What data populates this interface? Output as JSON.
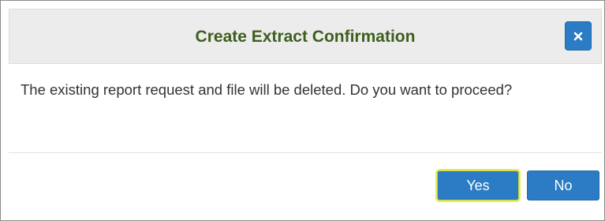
{
  "dialog": {
    "title": "Create Extract Confirmation",
    "close_icon": "close-icon",
    "message": "The existing report request and file will be deleted. Do you want to proceed?",
    "buttons": {
      "yes_label": "Yes",
      "no_label": "No"
    },
    "colors": {
      "title": "#3d5e1e",
      "button": "#2b7cc4",
      "focus_outline": "#e6ec5a"
    }
  }
}
